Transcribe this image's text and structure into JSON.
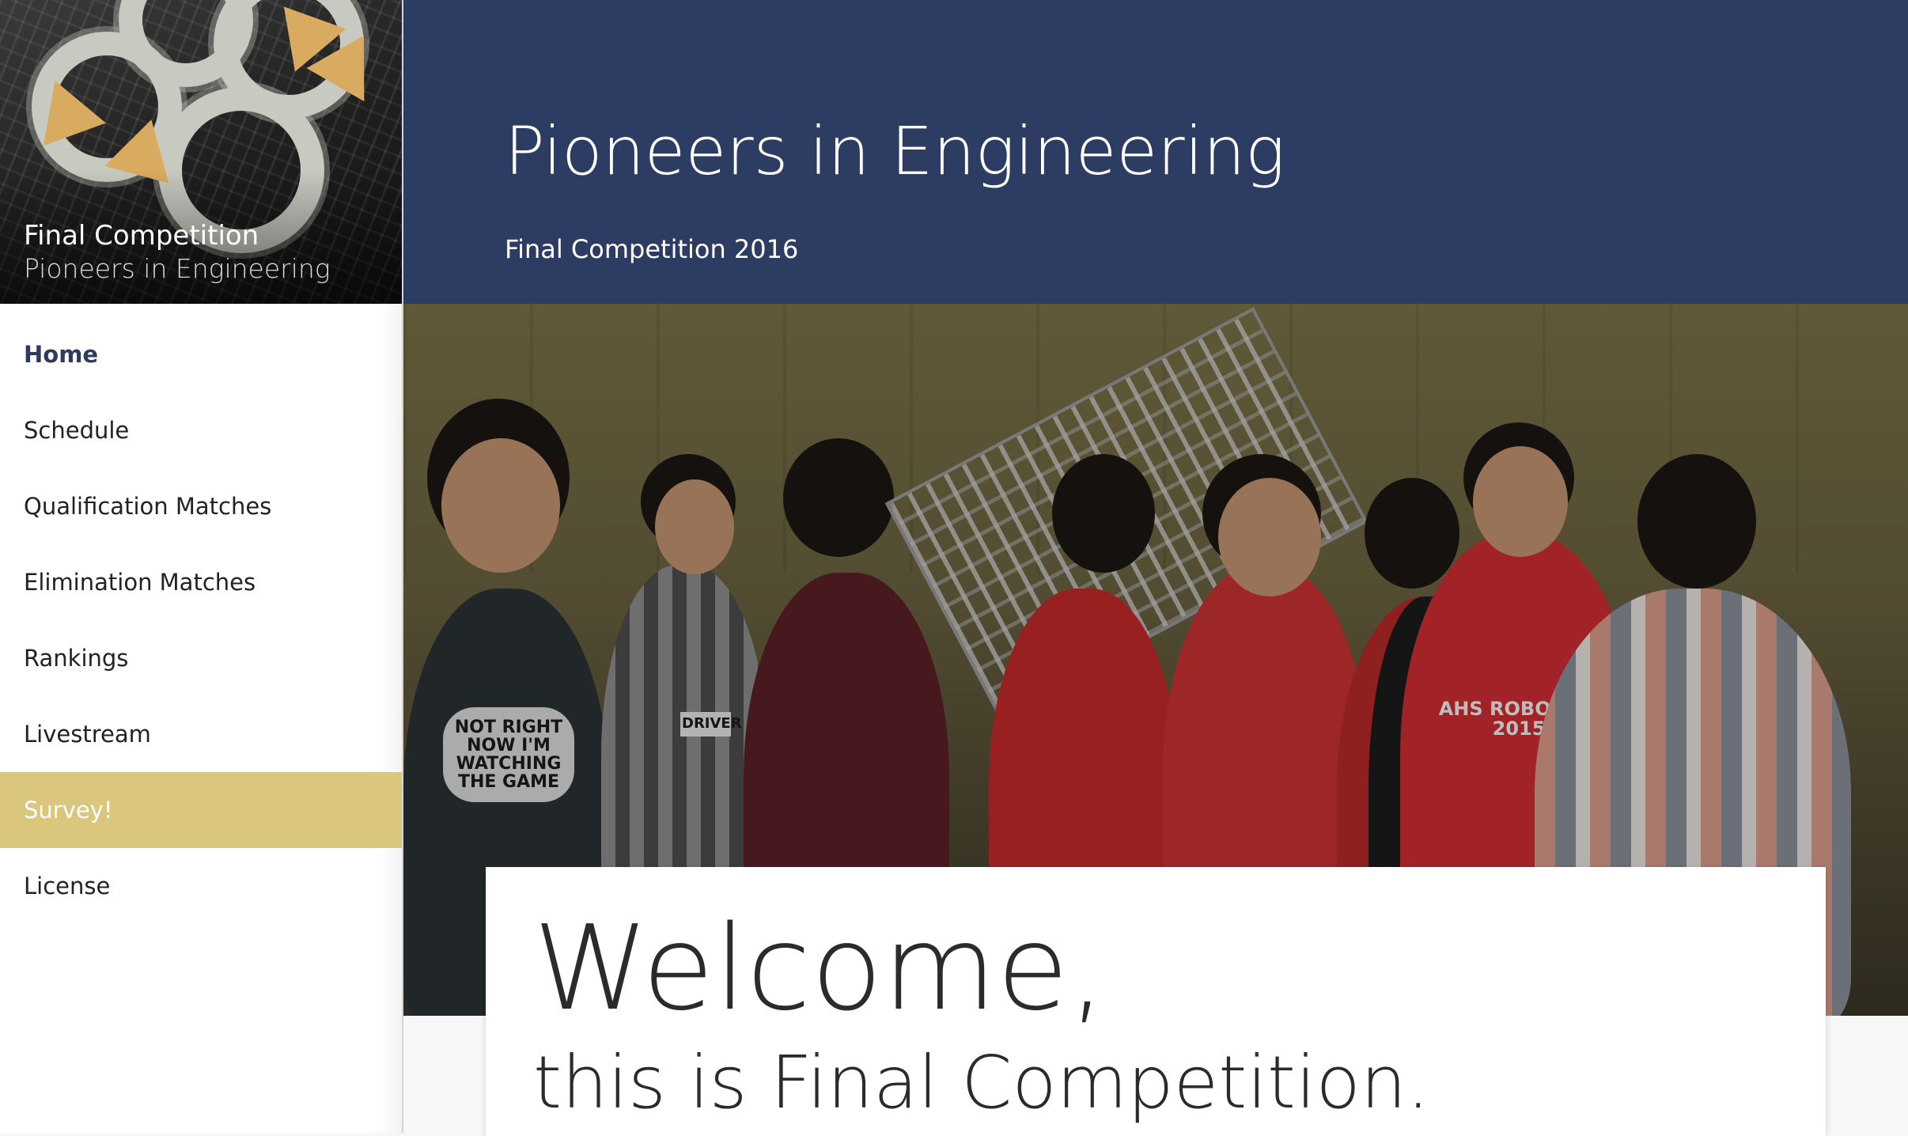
{
  "sidebar": {
    "brand_title": "Final Competition",
    "brand_subtitle": "Pioneers in Engineering",
    "nav": [
      {
        "label": "Home"
      },
      {
        "label": "Schedule"
      },
      {
        "label": "Qualification Matches"
      },
      {
        "label": "Elimination Matches"
      },
      {
        "label": "Rankings"
      },
      {
        "label": "Livestream"
      },
      {
        "label": "Survey!"
      },
      {
        "label": "License"
      }
    ],
    "active_item": "Home",
    "highlight_item": "Survey!"
  },
  "banner": {
    "title": "Pioneers in Engineering",
    "subtitle": "Final Competition 2016",
    "background_color": "#2d3c62"
  },
  "hero_photo": {
    "shirt_text_1": "NOT RIGHT NOW I'M WATCHING THE GAME",
    "badge_text": "DRIVER",
    "shirt_text_2": "AHS ROBOTICS 2015"
  },
  "welcome": {
    "line1": "Welcome,",
    "line2": "this is Final Competition."
  },
  "colors": {
    "accent_gold": "#dac67d",
    "navy": "#2d3c62"
  }
}
